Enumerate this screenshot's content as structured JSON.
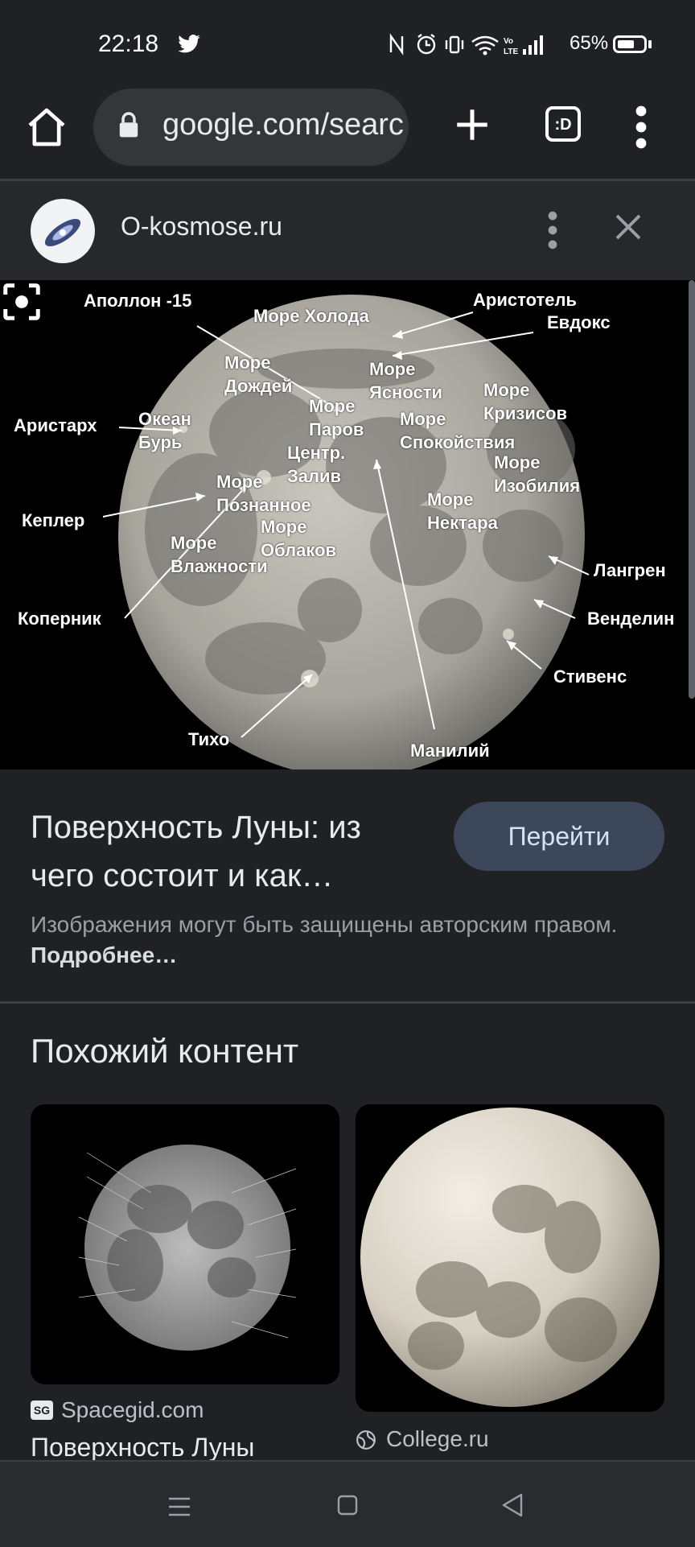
{
  "status_bar": {
    "time": "22:18",
    "battery": "65%",
    "battery_level": 0.65,
    "icons": [
      "twitter-icon",
      "nfc-icon",
      "alarm-icon",
      "vibrate-icon",
      "wifi-icon",
      "volte-icon",
      "signal-icon",
      "battery-icon"
    ]
  },
  "toolbar": {
    "url": "google.com/search",
    "tabs_count": ":D"
  },
  "preview": {
    "site_name": "O-kosmose.ru",
    "image_labels": {
      "apollo15": "Аполлон -15",
      "more_holoda": "Море Холода",
      "aristotel": "Аристотель",
      "evdoks": "Евдокс",
      "more_dozhdey_1": "Море",
      "more_dozhdey_2": "Дождей",
      "more_yasnosti_1": "Море",
      "more_yasnosti_2": "Ясности",
      "aristarh": "Аристарх",
      "more_krizisov_1": "Море",
      "more_krizisov_2": "Кризисов",
      "okean_bur_1": "Океан",
      "okean_bur_2": "Бурь",
      "more_parov_1": "Море",
      "more_parov_2": "Паров",
      "more_spokoystviya_1": "Море",
      "more_spokoystviya_2": "Спокойствия",
      "kepler": "Кеплер",
      "centr_zaliv_1": "Центр.",
      "centr_zaliv_2": "Залив",
      "more_izobiliya_1": "Море",
      "more_izobiliya_2": "Изобилия",
      "more_poznannoe_1": "Море",
      "more_poznannoe_2": "Познанное",
      "more_nektara_1": "Море",
      "more_nektara_2": "Нектара",
      "langren": "Лангрен",
      "more_oblakov_1": "Море",
      "more_oblakov_2": "Облаков",
      "kopernik": "Коперник",
      "more_vlazhnosti_1": "Море",
      "more_vlazhnosti_2": "Влажности",
      "vendelin": "Венделин",
      "stivens": "Стивенс",
      "tiho": "Тихо",
      "maniliy": "Манилий"
    },
    "title": "Поверхность Луны: из чего состоит и как…",
    "go_button": "Перейти",
    "copyright_text": "Изображения могут быть защищены авторским правом.",
    "copyright_link": "Подробнее…"
  },
  "related": {
    "heading": "Похожий контент",
    "items": [
      {
        "source_icon": "SG",
        "source": "Spacegid.com",
        "title": "Поверхность Луны"
      },
      {
        "source_icon": "globe-icon",
        "source": "College.ru"
      }
    ]
  },
  "colors": {
    "background": "#202124",
    "button_bg": "#3c4859",
    "button_text": "#d2e3fc"
  }
}
